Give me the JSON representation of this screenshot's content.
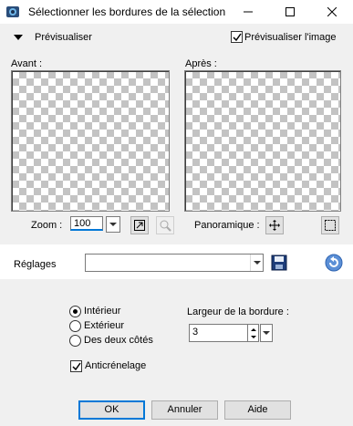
{
  "window": {
    "title": "Sélectionner les bordures de la sélection",
    "icon": "app-icon",
    "controls": [
      "minimize-icon",
      "maximize-icon",
      "close-icon"
    ]
  },
  "preview_header": {
    "label": "Prévisualiser",
    "preview_image_label": "Prévisualiser l'image",
    "preview_image_checked": true
  },
  "previews": {
    "before_label": "Avant :",
    "after_label": "Après :"
  },
  "zoom": {
    "label": "Zoom :",
    "value": "100",
    "pan_label": "Panoramique :"
  },
  "settings": {
    "label": "Réglages",
    "value": ""
  },
  "options": {
    "radio_inside": "Intérieur",
    "radio_outside": "Extérieur",
    "radio_both": "Des deux côtés",
    "selected": "Intérieur",
    "border_width_label": "Largeur de la bordure :",
    "border_width_value": "3",
    "antialias_label": "Anticrénelage",
    "antialias_checked": true
  },
  "buttons": {
    "ok": "OK",
    "cancel": "Annuler",
    "help": "Aide"
  },
  "colors": {
    "accent": "#0078d7",
    "dialog_bg": "#f0f0f0"
  }
}
